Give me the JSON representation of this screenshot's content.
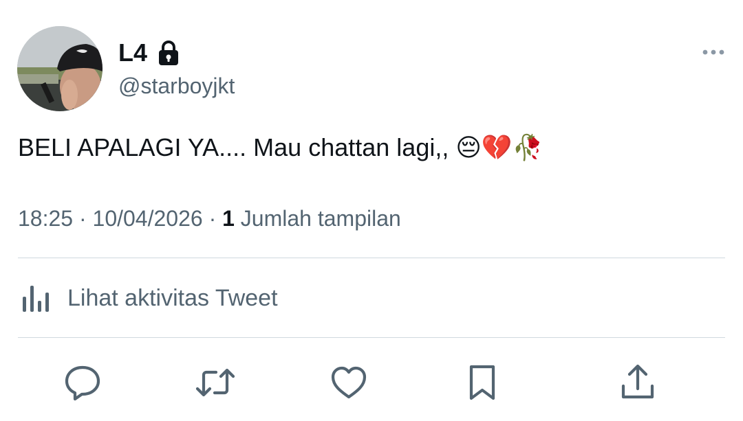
{
  "user": {
    "display_name": "L4",
    "handle": "@starboyjkt"
  },
  "tweet": {
    "text": "BELI APALAGI YA.... Mau chattan lagi,, 😔💔🥀",
    "time": "18:25",
    "date": "10/04/2026",
    "sep": "·",
    "views_count": "1",
    "views_label": "Jumlah tampilan"
  },
  "activity": {
    "label": "Lihat aktivitas Tweet"
  },
  "icons": {
    "avatar": "profile-photo",
    "lock": "lock-icon",
    "more": "more-horizontal-icon",
    "analytics": "analytics-bars-icon",
    "reply": "reply-bubble-icon",
    "retweet": "retweet-icon",
    "like": "heart-icon",
    "bookmark": "bookmark-icon",
    "share": "share-upload-icon"
  },
  "colors": {
    "text": "#0f1419",
    "secondary": "#536471",
    "divider": "#cfd9de"
  }
}
